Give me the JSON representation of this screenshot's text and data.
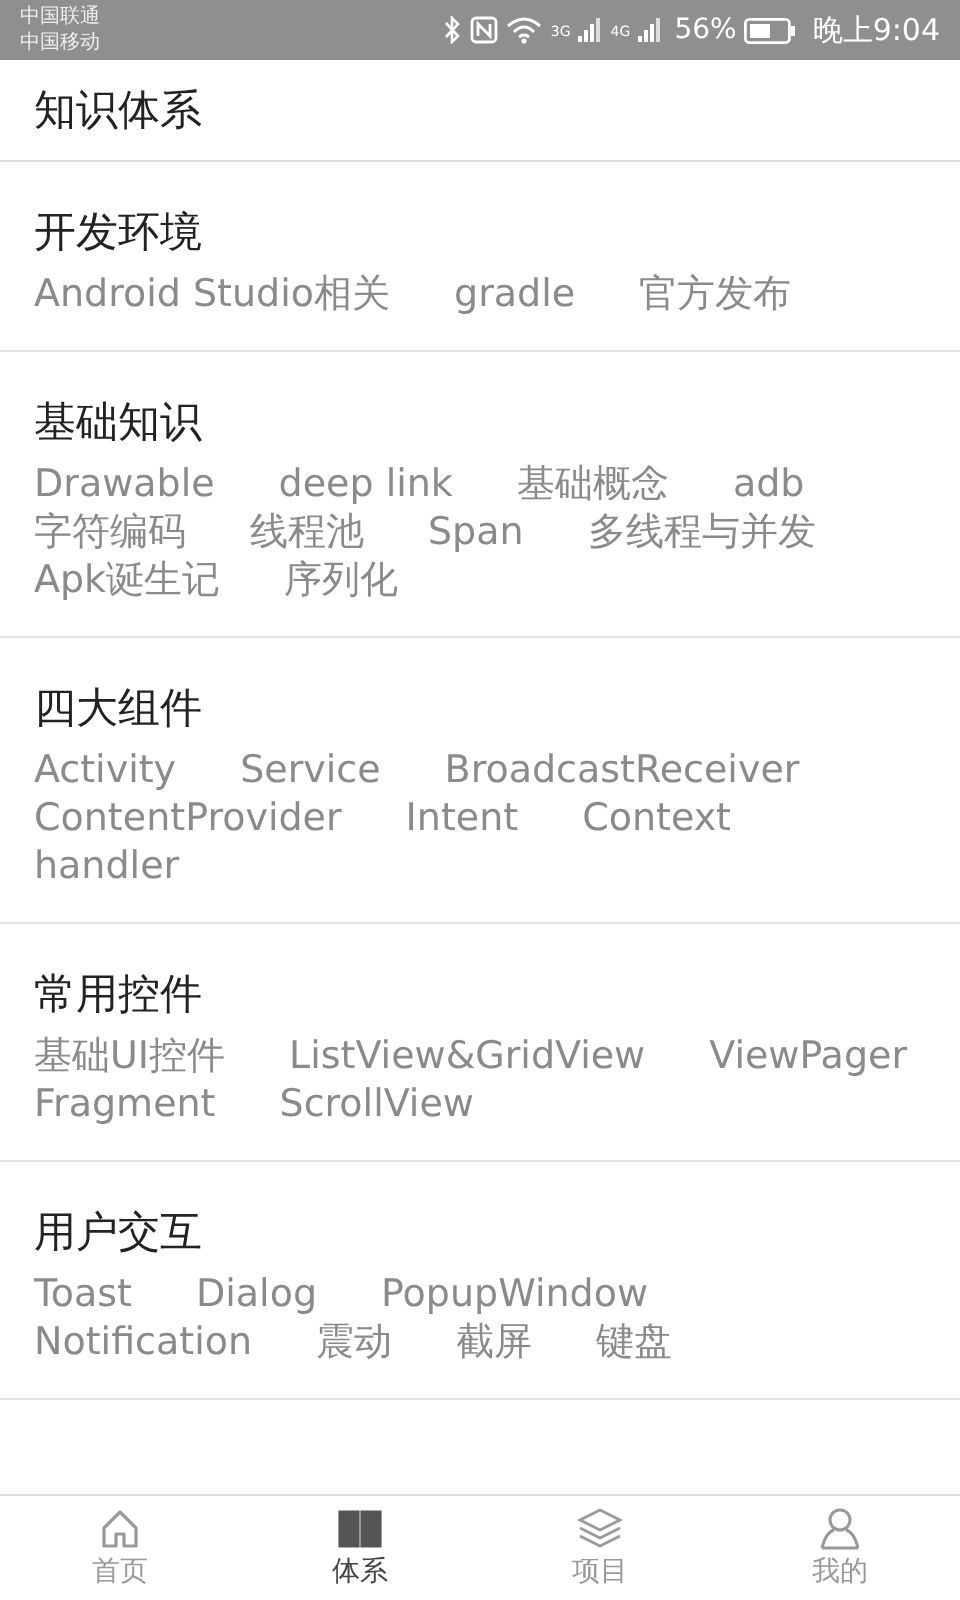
{
  "status_bar": {
    "carriers": [
      "中国联通",
      "中国移动"
    ],
    "network_labels": [
      "3G",
      "4G"
    ],
    "battery": "56%",
    "time": "晚上9:04"
  },
  "title": "知识体系",
  "categories": [
    {
      "name": "开发环境",
      "tags": [
        "Android Studio相关",
        "gradle",
        "官方发布"
      ]
    },
    {
      "name": "基础知识",
      "tags": [
        "Drawable",
        "deep link",
        "基础概念",
        "adb",
        "字符编码",
        "线程池",
        "Span",
        "多线程与并发",
        "Apk诞生记",
        "序列化"
      ]
    },
    {
      "name": "四大组件",
      "tags": [
        "Activity",
        "Service",
        "BroadcastReceiver",
        "ContentProvider",
        "Intent",
        "Context",
        "handler"
      ]
    },
    {
      "name": "常用控件",
      "tags": [
        "基础UI控件",
        "ListView&GridView",
        "ViewPager",
        "Fragment",
        "ScrollView"
      ]
    },
    {
      "name": "用户交互",
      "tags": [
        "Toast",
        "Dialog",
        "PopupWindow",
        "Notification",
        "震动",
        "截屏",
        "键盘"
      ]
    }
  ],
  "tabs": [
    {
      "label": "首页",
      "kind": "home",
      "selected": false
    },
    {
      "label": "体系",
      "kind": "book",
      "selected": true
    },
    {
      "label": "项目",
      "kind": "layers",
      "selected": false
    },
    {
      "label": "我的",
      "kind": "person",
      "selected": false
    }
  ]
}
